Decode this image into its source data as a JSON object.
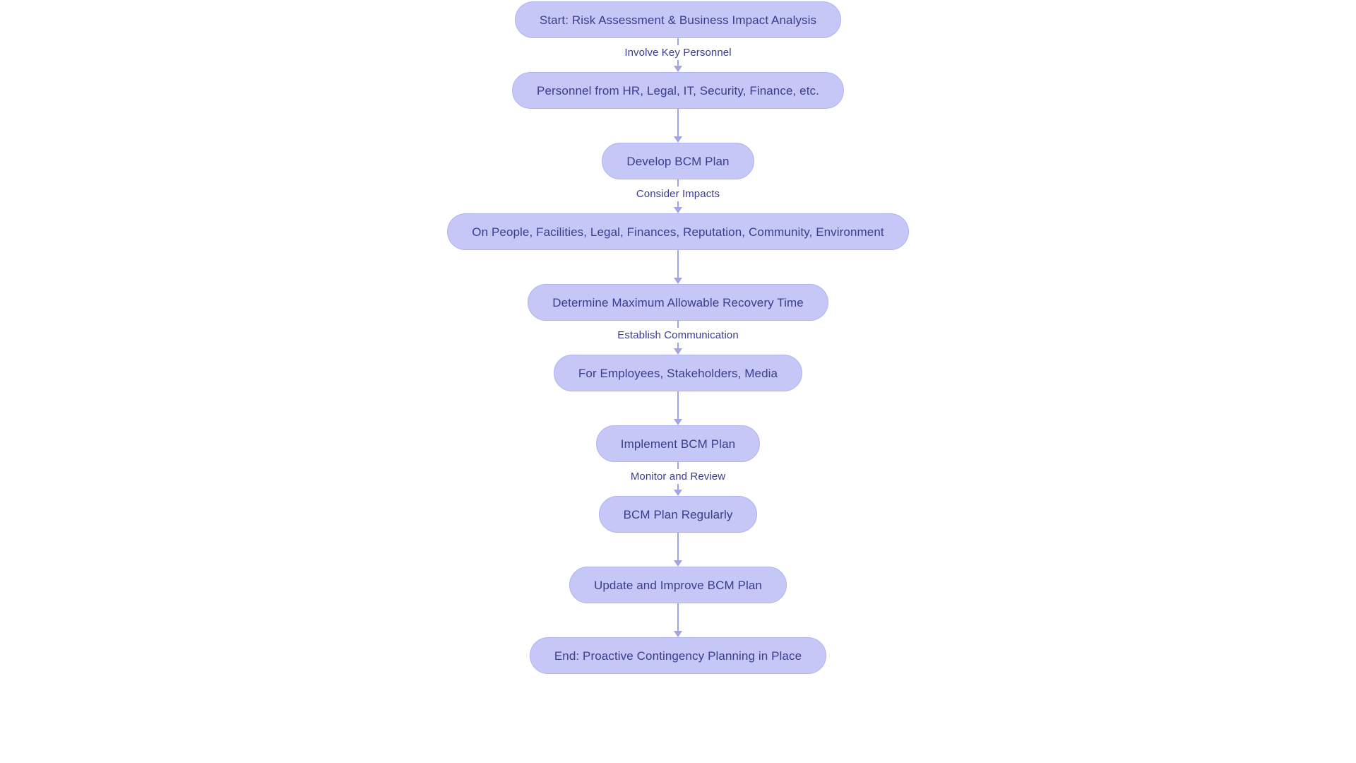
{
  "diagram": {
    "type": "flowchart",
    "orientation": "top-to-bottom",
    "colors": {
      "node_fill": "#c5c8f7",
      "node_border": "#b0b4ef",
      "node_text": "#3b3b8f",
      "connector": "#9fa3e8",
      "background": "#ffffff"
    },
    "nodes": [
      {
        "id": "n1",
        "label": "Start: Risk Assessment & Business Impact Analysis"
      },
      {
        "id": "n2",
        "label": "Personnel from HR, Legal, IT, Security, Finance, etc."
      },
      {
        "id": "n3",
        "label": "Develop BCM Plan"
      },
      {
        "id": "n4",
        "label": "On People, Facilities, Legal, Finances, Reputation, Community, Environment"
      },
      {
        "id": "n5",
        "label": "Determine Maximum Allowable Recovery Time"
      },
      {
        "id": "n6",
        "label": "For Employees, Stakeholders, Media"
      },
      {
        "id": "n7",
        "label": "Implement BCM Plan"
      },
      {
        "id": "n8",
        "label": "BCM Plan Regularly"
      },
      {
        "id": "n9",
        "label": "Update and Improve BCM Plan"
      },
      {
        "id": "n10",
        "label": "End: Proactive Contingency Planning in Place"
      }
    ],
    "edges": [
      {
        "from": "n1",
        "to": "n2",
        "label": "Involve Key Personnel"
      },
      {
        "from": "n2",
        "to": "n3",
        "label": ""
      },
      {
        "from": "n3",
        "to": "n4",
        "label": "Consider Impacts"
      },
      {
        "from": "n4",
        "to": "n5",
        "label": ""
      },
      {
        "from": "n5",
        "to": "n6",
        "label": "Establish Communication"
      },
      {
        "from": "n6",
        "to": "n7",
        "label": ""
      },
      {
        "from": "n7",
        "to": "n8",
        "label": "Monitor and Review"
      },
      {
        "from": "n8",
        "to": "n9",
        "label": ""
      },
      {
        "from": "n9",
        "to": "n10",
        "label": ""
      }
    ]
  }
}
